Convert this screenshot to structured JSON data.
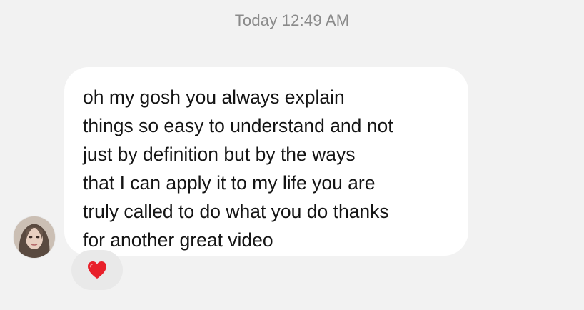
{
  "header": {
    "timestamp": "Today 12:49 AM"
  },
  "message": {
    "text": "oh my gosh you always explain\nthings so easy to understand and not\njust by definition but by the ways\nthat I can apply it to my life you are\ntruly called to do what you do thanks\nfor another great video",
    "sender_avatar_icon": "user-avatar-photo"
  },
  "reaction": {
    "icon": "red-heart-icon",
    "color": "#e8202a"
  },
  "colors": {
    "background": "#f2f2f2",
    "bubble": "#ffffff",
    "timestamp": "#8a8a8a",
    "text": "#141414",
    "reaction_pill": "#e9e9e9"
  }
}
